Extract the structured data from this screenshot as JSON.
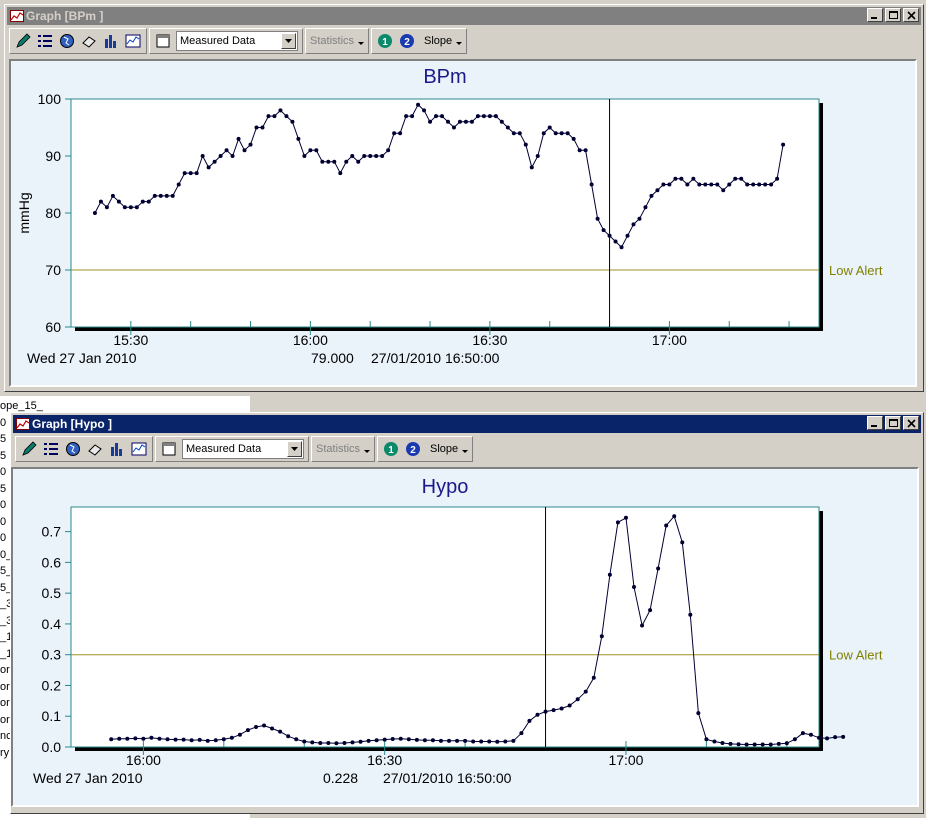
{
  "background": {
    "items": [
      "ope_15_",
      "0",
      "5",
      "5",
      "0",
      "5",
      "0",
      "0",
      "0",
      "0_",
      "5_",
      "5_",
      "_3",
      "_3",
      "_1",
      "_1",
      "or",
      "or",
      "or",
      "or",
      "nc",
      "ry"
    ]
  },
  "windows": [
    {
      "id": "bpm",
      "title": "Graph [BPm ]",
      "active": false,
      "toolbar": {
        "combo_value": "Measured Data",
        "statistics_label": "Statistics",
        "slope_label": "Slope",
        "circle1": "1",
        "circle2": "2"
      },
      "chart_data": {
        "type": "line",
        "title": "BPm",
        "ylabel": "mmHg",
        "xlabel": "",
        "ylim": [
          60,
          100
        ],
        "yticks": [
          "60",
          "70",
          "80",
          "90",
          "100"
        ],
        "xlim": [
          "15:20",
          "17:25"
        ],
        "xticks": [
          "15:30",
          "16:00",
          "16:30",
          "17:00"
        ],
        "date_label": "Wed 27 Jan 2010",
        "cursor_x": "16:50",
        "cursor_readout": "79.000",
        "cursor_timestamp": "27/01/2010 16:50:00",
        "threshold": {
          "label": "Low Alert",
          "value": 70,
          "color": "#a09020"
        },
        "series": [
          {
            "color": "#000033",
            "values": [
              [
                0,
                80
              ],
              [
                1,
                82
              ],
              [
                2,
                81
              ],
              [
                3,
                83
              ],
              [
                4,
                82
              ],
              [
                5,
                81
              ],
              [
                6,
                81
              ],
              [
                7,
                81
              ],
              [
                8,
                82
              ],
              [
                9,
                82
              ],
              [
                10,
                83
              ],
              [
                11,
                83
              ],
              [
                12,
                83
              ],
              [
                13,
                83
              ],
              [
                14,
                85
              ],
              [
                15,
                87
              ],
              [
                16,
                87
              ],
              [
                17,
                87
              ],
              [
                18,
                90
              ],
              [
                19,
                88
              ],
              [
                20,
                89
              ],
              [
                21,
                90
              ],
              [
                22,
                91
              ],
              [
                23,
                90
              ],
              [
                24,
                93
              ],
              [
                25,
                91
              ],
              [
                26,
                92
              ],
              [
                27,
                95
              ],
              [
                28,
                95
              ],
              [
                29,
                97
              ],
              [
                30,
                97
              ],
              [
                31,
                98
              ],
              [
                32,
                97
              ],
              [
                33,
                96
              ],
              [
                34,
                93
              ],
              [
                35,
                90
              ],
              [
                36,
                91
              ],
              [
                37,
                91
              ],
              [
                38,
                89
              ],
              [
                39,
                89
              ],
              [
                40,
                89
              ],
              [
                41,
                87
              ],
              [
                42,
                89
              ],
              [
                43,
                90
              ],
              [
                44,
                89
              ],
              [
                45,
                90
              ],
              [
                46,
                90
              ],
              [
                47,
                90
              ],
              [
                48,
                90
              ],
              [
                49,
                91
              ],
              [
                50,
                94
              ],
              [
                51,
                94
              ],
              [
                52,
                97
              ],
              [
                53,
                97
              ],
              [
                54,
                99
              ],
              [
                55,
                98
              ],
              [
                56,
                96
              ],
              [
                57,
                97
              ],
              [
                58,
                97
              ],
              [
                59,
                96
              ],
              [
                60,
                95
              ],
              [
                61,
                96
              ],
              [
                62,
                96
              ],
              [
                63,
                96
              ],
              [
                64,
                97
              ],
              [
                65,
                97
              ],
              [
                66,
                97
              ],
              [
                67,
                97
              ],
              [
                68,
                96
              ],
              [
                69,
                95
              ],
              [
                70,
                94
              ],
              [
                71,
                94
              ],
              [
                72,
                92
              ],
              [
                73,
                88
              ],
              [
                74,
                90
              ],
              [
                75,
                94
              ],
              [
                76,
                95
              ],
              [
                77,
                94
              ],
              [
                78,
                94
              ],
              [
                79,
                94
              ],
              [
                80,
                93
              ],
              [
                81,
                91
              ],
              [
                82,
                91
              ],
              [
                83,
                85
              ],
              [
                84,
                79
              ],
              [
                85,
                77
              ],
              [
                86,
                76
              ],
              [
                87,
                75
              ],
              [
                88,
                74
              ],
              [
                89,
                76
              ],
              [
                90,
                78
              ],
              [
                91,
                79
              ],
              [
                92,
                81
              ],
              [
                93,
                83
              ],
              [
                94,
                84
              ],
              [
                95,
                85
              ],
              [
                96,
                85
              ],
              [
                97,
                86
              ],
              [
                98,
                86
              ],
              [
                99,
                85
              ],
              [
                100,
                86
              ],
              [
                101,
                85
              ],
              [
                102,
                85
              ],
              [
                103,
                85
              ],
              [
                104,
                85
              ],
              [
                105,
                84
              ],
              [
                106,
                85
              ],
              [
                107,
                86
              ],
              [
                108,
                86
              ],
              [
                109,
                85
              ],
              [
                110,
                85
              ],
              [
                111,
                85
              ],
              [
                112,
                85
              ],
              [
                113,
                85
              ],
              [
                114,
                86
              ],
              [
                115,
                92
              ]
            ]
          }
        ],
        "x_start": "15:24",
        "x_step_minutes": 1
      }
    },
    {
      "id": "hypo",
      "title": "Graph [Hypo ]",
      "active": true,
      "toolbar": {
        "combo_value": "Measured Data",
        "statistics_label": "Statistics",
        "slope_label": "Slope",
        "circle1": "1",
        "circle2": "2"
      },
      "chart_data": {
        "type": "line",
        "title": "Hypo",
        "ylabel": "",
        "xlabel": "",
        "ylim": [
          0,
          0.78
        ],
        "yticks": [
          "0.0",
          "0.1",
          "0.2",
          "0.3",
          "0.4",
          "0.5",
          "0.6",
          "0.7"
        ],
        "xlim": [
          "15:51",
          "17:24"
        ],
        "xticks": [
          "16:00",
          "16:30",
          "17:00"
        ],
        "date_label": "Wed 27 Jan 2010",
        "cursor_x": "16:50",
        "cursor_readout": "0.228",
        "cursor_timestamp": "27/01/2010 16:50:00",
        "threshold": {
          "label": "Low Alert",
          "value": 0.3,
          "color": "#a09020"
        },
        "series": [
          {
            "color": "#000033",
            "values": [
              [
                0,
                0.025
              ],
              [
                1,
                0.027
              ],
              [
                2,
                0.027
              ],
              [
                3,
                0.028
              ],
              [
                4,
                0.027
              ],
              [
                5,
                0.03
              ],
              [
                6,
                0.027
              ],
              [
                7,
                0.025
              ],
              [
                8,
                0.024
              ],
              [
                9,
                0.024
              ],
              [
                10,
                0.022
              ],
              [
                11,
                0.023
              ],
              [
                12,
                0.02
              ],
              [
                13,
                0.022
              ],
              [
                14,
                0.025
              ],
              [
                15,
                0.03
              ],
              [
                16,
                0.04
              ],
              [
                17,
                0.055
              ],
              [
                18,
                0.065
              ],
              [
                19,
                0.07
              ],
              [
                20,
                0.06
              ],
              [
                21,
                0.05
              ],
              [
                22,
                0.035
              ],
              [
                23,
                0.025
              ],
              [
                24,
                0.018
              ],
              [
                25,
                0.015
              ],
              [
                26,
                0.013
              ],
              [
                27,
                0.013
              ],
              [
                28,
                0.012
              ],
              [
                29,
                0.013
              ],
              [
                30,
                0.015
              ],
              [
                31,
                0.017
              ],
              [
                32,
                0.02
              ],
              [
                33,
                0.022
              ],
              [
                34,
                0.024
              ],
              [
                35,
                0.026
              ],
              [
                36,
                0.027
              ],
              [
                37,
                0.025
              ],
              [
                38,
                0.023
              ],
              [
                39,
                0.022
              ],
              [
                40,
                0.022
              ],
              [
                41,
                0.02
              ],
              [
                42,
                0.02
              ],
              [
                43,
                0.02
              ],
              [
                44,
                0.02
              ],
              [
                45,
                0.018
              ],
              [
                46,
                0.018
              ],
              [
                47,
                0.018
              ],
              [
                48,
                0.017
              ],
              [
                49,
                0.018
              ],
              [
                50,
                0.02
              ],
              [
                51,
                0.045
              ],
              [
                52,
                0.085
              ],
              [
                53,
                0.105
              ],
              [
                54,
                0.115
              ],
              [
                55,
                0.12
              ],
              [
                56,
                0.125
              ],
              [
                57,
                0.135
              ],
              [
                58,
                0.155
              ],
              [
                59,
                0.18
              ],
              [
                60,
                0.225
              ],
              [
                61,
                0.36
              ],
              [
                62,
                0.56
              ],
              [
                63,
                0.73
              ],
              [
                64,
                0.745
              ],
              [
                65,
                0.52
              ],
              [
                66,
                0.395
              ],
              [
                67,
                0.445
              ],
              [
                68,
                0.58
              ],
              [
                69,
                0.72
              ],
              [
                70,
                0.75
              ],
              [
                71,
                0.665
              ],
              [
                72,
                0.43
              ],
              [
                73,
                0.11
              ],
              [
                74,
                0.025
              ],
              [
                75,
                0.018
              ],
              [
                76,
                0.013
              ],
              [
                77,
                0.01
              ],
              [
                78,
                0.009
              ],
              [
                79,
                0.008
              ],
              [
                80,
                0.008
              ],
              [
                81,
                0.008
              ],
              [
                82,
                0.008
              ],
              [
                83,
                0.01
              ],
              [
                84,
                0.012
              ],
              [
                85,
                0.025
              ],
              [
                86,
                0.045
              ],
              [
                87,
                0.04
              ],
              [
                88,
                0.03
              ],
              [
                89,
                0.028
              ],
              [
                90,
                0.032
              ],
              [
                91,
                0.033
              ]
            ]
          }
        ],
        "x_start": "15:56",
        "x_step_minutes": 1
      }
    }
  ]
}
